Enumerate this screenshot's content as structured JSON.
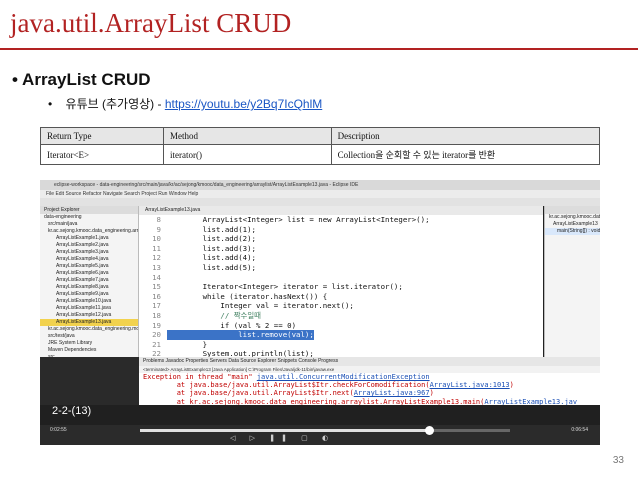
{
  "slide": {
    "title": "java.util.ArrayList CRUD",
    "bullet_main": "ArrayList CRUD",
    "bullet_sub_prefix": "유튜브 (추가영상) - ",
    "bullet_sub_link": "https://youtu.be/y2Bq7IcQhlM",
    "page_number": "33"
  },
  "ref_table": {
    "headers": [
      "Return Type",
      "Method",
      "Description"
    ],
    "row": [
      "Iterator<E>",
      "iterator()",
      "Collection을 순회할 수 있는 iterator를 반환"
    ]
  },
  "ide": {
    "title": "eclipse-workspace - data-engineering/src/main/java/kr/ac/sejong/kmooc/data_engineering/arraylist/ArrayListExample13.java - Eclipse IDE",
    "menu": "File  Edit  Source  Refactor  Navigate  Search  Project  Run  Window  Help",
    "explorer_header": "Project Explorer",
    "explorer_items": [
      "data-engineering",
      "src/main/java",
      "kr.ac.sejong.kmooc.data_engineering.arraylist",
      "ArrayListExample1.java",
      "ArrayListExample2.java",
      "ArrayListExample3.java",
      "ArrayListExample4.java",
      "ArrayListExample5.java",
      "ArrayListExample6.java",
      "ArrayListExample7.java",
      "ArrayListExample8.java",
      "ArrayListExample9.java",
      "ArrayListExample10.java",
      "ArrayListExample11.java",
      "ArrayListExample12.java",
      "ArrayListExample13.java",
      "kr.ac.sejong.kmooc.data_engineering.motivation",
      "src/test/java",
      "JRE System Library",
      "Maven Dependencies",
      "src",
      "target",
      "pom.xml"
    ],
    "explorer_selected_index": 15,
    "editor_tab": "ArrayListExample13.java",
    "code_lines": [
      {
        "n": "8",
        "text": "        ArrayList<Integer> list = new ArrayList<Integer>();"
      },
      {
        "n": "9",
        "text": "        list.add(1);"
      },
      {
        "n": "10",
        "text": "        list.add(2);"
      },
      {
        "n": "11",
        "text": "        list.add(3);"
      },
      {
        "n": "12",
        "text": "        list.add(4);"
      },
      {
        "n": "13",
        "text": "        list.add(5);"
      },
      {
        "n": "14",
        "text": ""
      },
      {
        "n": "15",
        "text": "        Iterator<Integer> iterator = list.iterator();"
      },
      {
        "n": "16",
        "text": "        while (iterator.hasNext()) {"
      },
      {
        "n": "17",
        "text": "            Integer val = iterator.next();"
      },
      {
        "n": "18",
        "text": "            // 짝수일때"
      },
      {
        "n": "19",
        "text": "            if (val % 2 == 0)"
      },
      {
        "n": "20",
        "text": "                list.remove(val);"
      },
      {
        "n": "21",
        "text": "        }"
      },
      {
        "n": "22",
        "text": "        System.out.println(list);"
      },
      {
        "n": "23",
        "text": "    }"
      },
      {
        "n": "24",
        "text": "}"
      },
      {
        "n": "25",
        "text": ""
      }
    ],
    "outline_items": [
      "kr.ac.sejong.kmooc.data_engineering",
      "ArrayListExample13",
      "main(String[]) : void"
    ],
    "bottom_tabs": "Problems   Javadoc   Properties   Servers   Data Source Explorer   Snippets   Console   Progress",
    "console_header": "<terminated> ArrayListExample13 [Java Application] C:\\Program Files\\Java\\jdk-11\\bin\\javaw.exe",
    "console_lines": [
      {
        "pre": "Exception in thread \"main\" ",
        "link": "java.util.ConcurrentModificationException",
        "post": ""
      },
      {
        "pre": "        at java.base/java.util.ArrayList$Itr.checkForComodification(",
        "link": "ArrayList.java:1013",
        "post": ")"
      },
      {
        "pre": "        at java.base/java.util.ArrayList$Itr.next(",
        "link": "ArrayList.java:967",
        "post": ")"
      },
      {
        "pre": "        at kr.ac.sejong.kmooc.data_engineering.arraylist.ArrayListExample13.main(",
        "link": "ArrayListExample13.jav",
        "post": ""
      }
    ]
  },
  "video": {
    "subtitle": "2-2-(13)",
    "time_current": "0:02:55",
    "time_total": "0:06:54",
    "progress_fraction": 0.78,
    "controls": "◁ ▷ ❚❚ ▢ ◐"
  }
}
